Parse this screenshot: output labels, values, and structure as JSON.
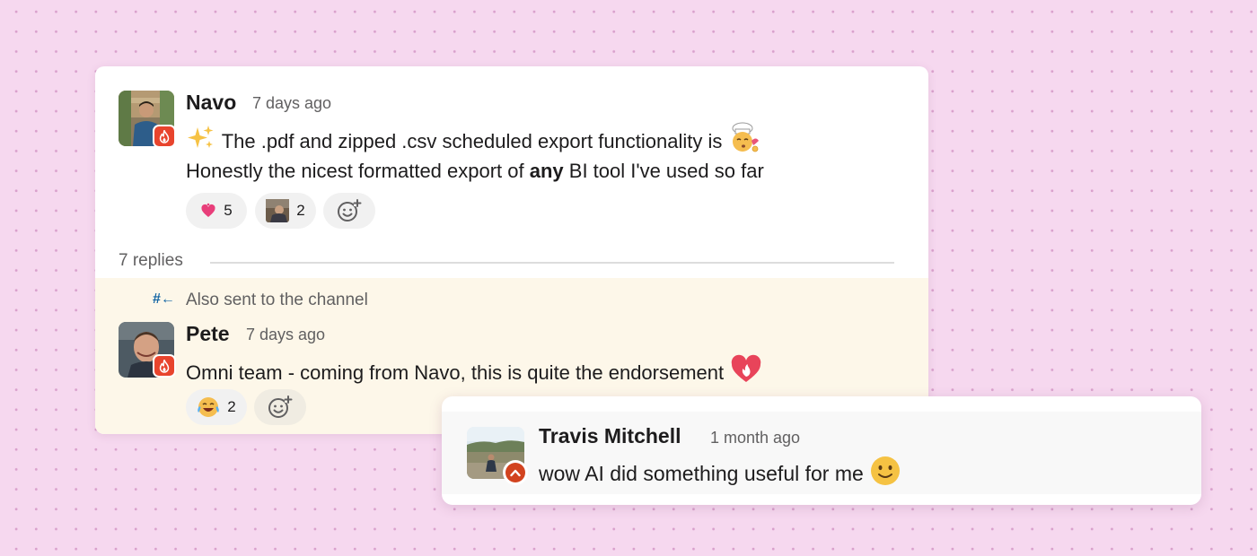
{
  "thread": {
    "message": {
      "author": "Navo",
      "time": "7 days ago",
      "line1": "The .pdf and zipped .csv scheduled export functionality is",
      "line2_before": "Honestly the nicest formatted export of ",
      "line2_bold": "any",
      "line2_after": " BI tool I've used so far",
      "emoji_leading": "sparkles",
      "emoji_trailing": "chef-kiss",
      "reactions": [
        {
          "emoji": "heart-exclamation",
          "count": "5"
        },
        {
          "emoji": "avatar-photo",
          "count": "2"
        }
      ]
    },
    "replies_label": "7 replies",
    "reply": {
      "also_sent_icon": "#←",
      "also_sent": "Also sent to the channel",
      "author": "Pete",
      "time": "7 days ago",
      "text": "Omni team - coming from Navo, this is quite the endorsement",
      "emoji_trailing": "heart-on-fire",
      "reactions": [
        {
          "emoji": "joy",
          "count": "2"
        }
      ]
    }
  },
  "floating_message": {
    "author": "Travis Mitchell",
    "time": "1 month ago",
    "text": "wow AI did something useful for me",
    "emoji_trailing": "slightly-smiling-face"
  },
  "colors": {
    "background": "#f6d8ef",
    "badge": "#e8442d",
    "link_blue": "#1264a3",
    "reply_background": "#fdf7e9"
  }
}
